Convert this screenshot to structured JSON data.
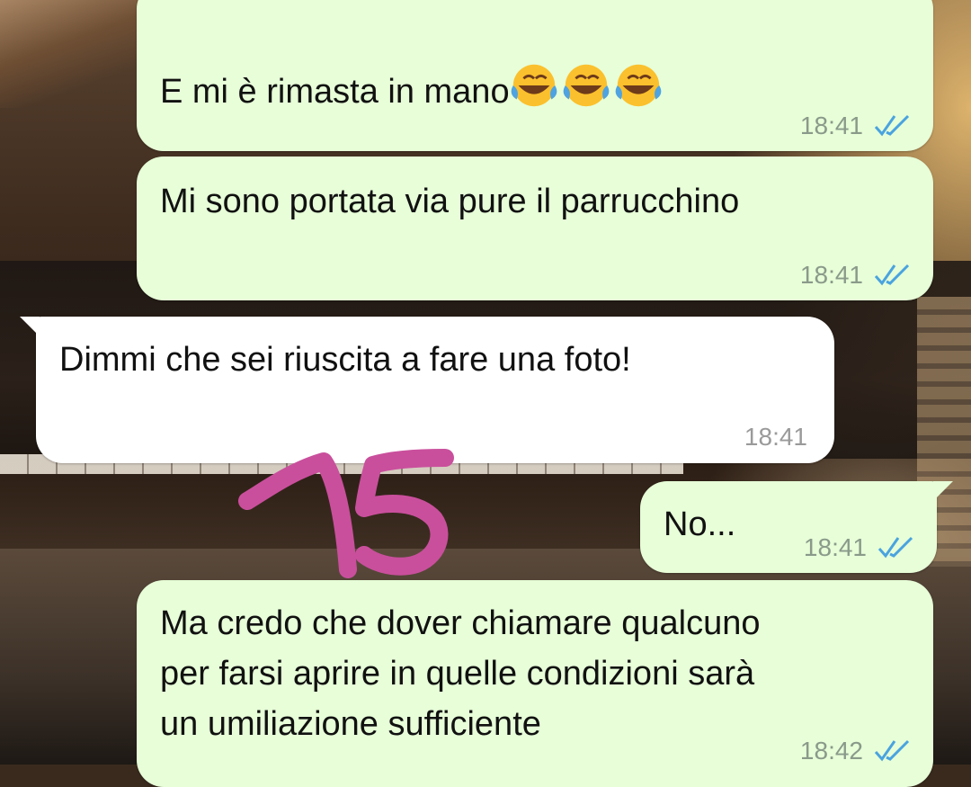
{
  "messages": [
    {
      "direction": "outgoing",
      "text": "E mi è rimasta in mano",
      "emoji": [
        "tears-of-joy",
        "tears-of-joy",
        "tears-of-joy"
      ],
      "time": "18:41",
      "status": "read"
    },
    {
      "direction": "outgoing",
      "text": "Mi sono portata via pure il parrucchino",
      "time": "18:41",
      "status": "read"
    },
    {
      "direction": "incoming",
      "text": "Dimmi che sei riuscita a fare una foto!",
      "time": "18:41"
    },
    {
      "direction": "outgoing",
      "text": "No...",
      "time": "18:41",
      "status": "read"
    },
    {
      "direction": "outgoing",
      "text": "Ma credo che dover chiamare qualcuno\nper farsi aprire in quelle condizioni sarà\nun umiliazione sufficiente",
      "time": "18:42",
      "status": "read"
    }
  ],
  "annotation": {
    "text": "15",
    "color": "#c94f9c"
  },
  "colors": {
    "outgoing_bubble": "#e7fed8",
    "incoming_bubble": "#ffffff",
    "read_ticks": "#4aa3df",
    "timestamp": "#8a9a8a"
  }
}
